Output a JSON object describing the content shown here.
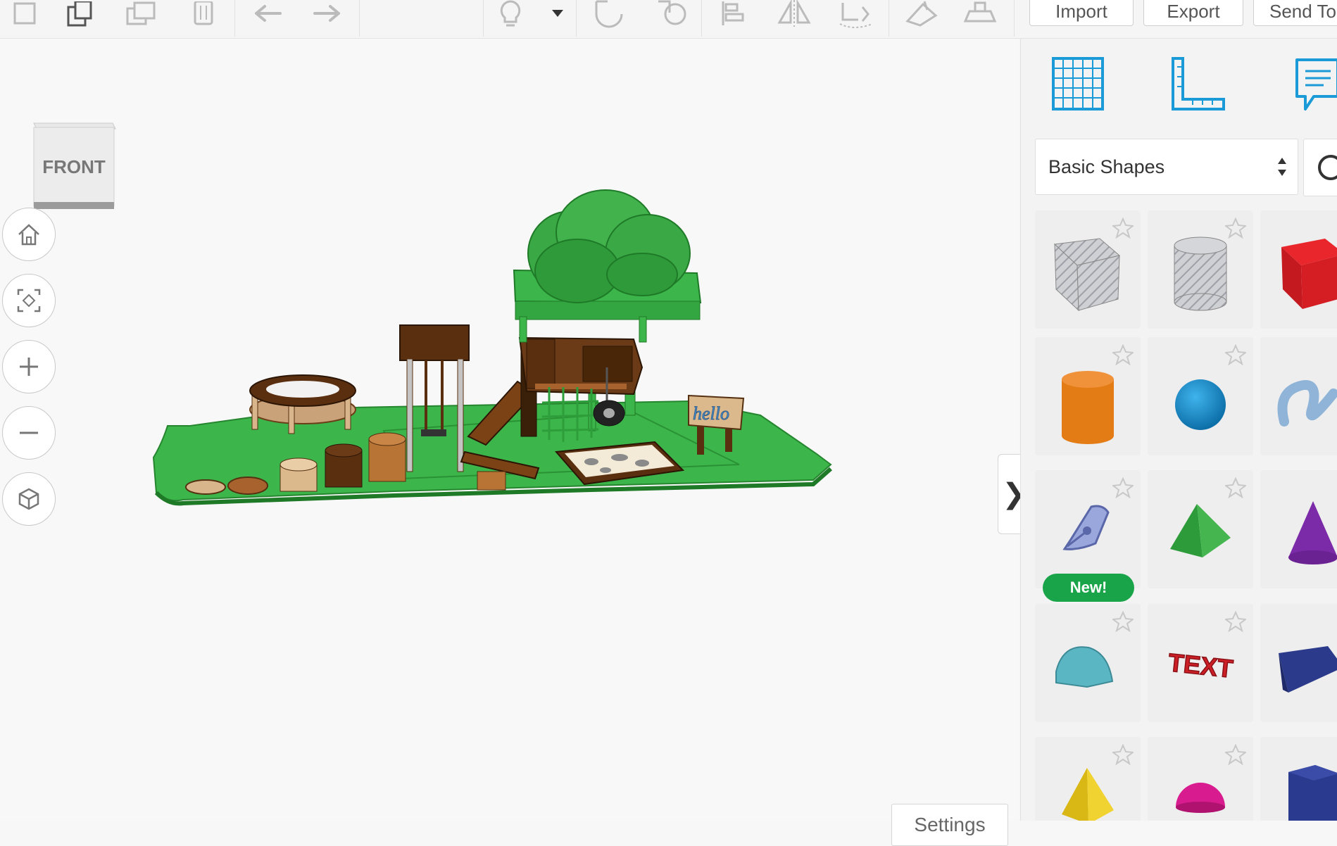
{
  "toolbar": {
    "icons": [
      "new-shape-icon",
      "copy-icon",
      "duplicate-icon",
      "delete-icon",
      "undo-icon",
      "redo-icon",
      "lightbulb-icon",
      "dropdown-icon",
      "note-icon",
      "ruler-tool-icon",
      "align-icon",
      "mirror-icon",
      "group-icon",
      "ungroup-icon",
      "workplane-icon"
    ],
    "import_label": "Import",
    "export_label": "Export",
    "sendto_label": "Send To"
  },
  "viewport": {
    "viewcube_label": "FRONT",
    "nav_buttons": [
      "home-view-icon",
      "fit-view-icon",
      "zoom-in-icon",
      "zoom-out-icon",
      "ortho-view-icon"
    ],
    "settings_label": "Settings",
    "collapse_label": "❯",
    "scene_sign_text": "hello"
  },
  "panel": {
    "top_icons": [
      "grid-icon",
      "ruler-icon",
      "notes-icon"
    ],
    "category": "Basic Shapes",
    "new_badge": "New!",
    "shapes": [
      {
        "name": "box-hole",
        "color": "#b7b9bf"
      },
      {
        "name": "cylinder-hole",
        "color": "#c0c2c7"
      },
      {
        "name": "box",
        "color": "#d41e24"
      },
      {
        "name": "cylinder",
        "color": "#e47c15"
      },
      {
        "name": "sphere",
        "color": "#1388c7"
      },
      {
        "name": "scribble",
        "color": "#8fb4d8"
      },
      {
        "name": "shape-generator",
        "color": "#9aa7dc"
      },
      {
        "name": "roof",
        "color": "#2fa43c"
      },
      {
        "name": "cone",
        "color": "#7b2aa8"
      },
      {
        "name": "round-roof",
        "color": "#5bb6c4"
      },
      {
        "name": "text",
        "color": "#cc1f26"
      },
      {
        "name": "wedge",
        "color": "#2b3a8a"
      },
      {
        "name": "pyramid",
        "color": "#e9c81c"
      },
      {
        "name": "half-sphere",
        "color": "#d81c8f"
      },
      {
        "name": "polygon",
        "color": "#2a3a8f"
      }
    ]
  }
}
